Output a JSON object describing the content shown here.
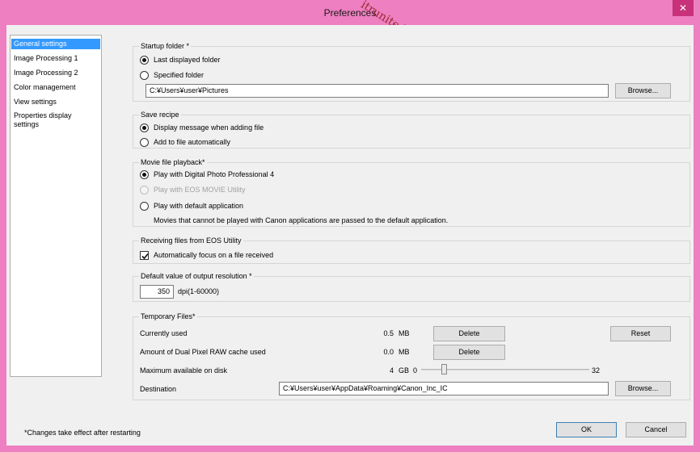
{
  "window": {
    "title": "Preferences",
    "watermark": "itrunite.be",
    "close_glyph": "✕"
  },
  "sidebar": {
    "items": [
      {
        "label": "General settings",
        "selected": true
      },
      {
        "label": "Image Processing 1",
        "selected": false
      },
      {
        "label": "Image Processing 2",
        "selected": false
      },
      {
        "label": "Color management",
        "selected": false
      },
      {
        "label": "View settings",
        "selected": false
      },
      {
        "label": "Properties display settings",
        "selected": false
      }
    ]
  },
  "startup": {
    "title": "Startup folder *",
    "option_last": "Last displayed folder",
    "option_specified": "Specified folder",
    "selected": "last",
    "path": "C:¥Users¥user¥Pictures",
    "browse": "Browse..."
  },
  "recipe": {
    "title": "Save recipe",
    "option_message": "Display message when adding file",
    "option_auto": "Add to file automatically",
    "selected": "message"
  },
  "movie": {
    "title": "Movie file playback*",
    "option_dpp": "Play with Digital Photo Professional 4",
    "option_eos": "Play with EOS MOVIE Utility",
    "option_default": "Play with default application",
    "note": "Movies that cannot be played with Canon applications are passed to the default application.",
    "selected": "dpp"
  },
  "receiving": {
    "title": "Receiving files from EOS Utility",
    "checkbox_label": "Automatically focus on a file received",
    "checked": true
  },
  "resolution": {
    "title": "Default value of output resolution *",
    "value": "350",
    "unit": "dpi(1-60000)"
  },
  "temp": {
    "title": "Temporary Files*",
    "currently_used_label": "Currently used",
    "currently_used_value": "0.5",
    "currently_used_unit": "MB",
    "delete1": "Delete",
    "reset": "Reset",
    "dual_pixel_label": "Amount of Dual Pixel RAW cache used",
    "dual_pixel_value": "0.0",
    "dual_pixel_unit": "MB",
    "delete2": "Delete",
    "max_label": "Maximum available on disk",
    "max_value": "4",
    "max_unit": "GB",
    "slider_min": "0",
    "slider_max": "32",
    "slider_value": 4,
    "destination_label": "Destination",
    "destination_path": "C:¥Users¥user¥AppData¥Roaming¥Canon_Inc_IC",
    "browse": "Browse..."
  },
  "footer": {
    "note": "*Changes take effect after restarting",
    "ok": "OK",
    "cancel": "Cancel"
  }
}
